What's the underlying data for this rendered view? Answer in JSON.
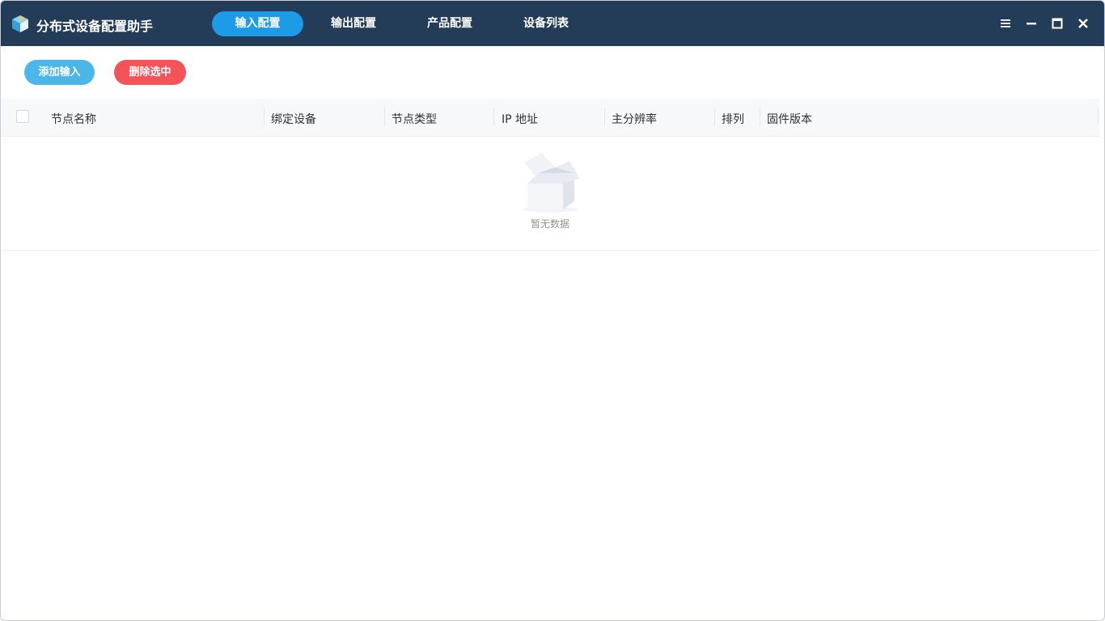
{
  "app": {
    "title": "分布式设备配置助手",
    "logo_icon": "cube-icon"
  },
  "nav": {
    "tabs": [
      {
        "label": "输入配置",
        "active": true
      },
      {
        "label": "输出配置",
        "active": false
      },
      {
        "label": "产品配置",
        "active": false
      },
      {
        "label": "设备列表",
        "active": false
      }
    ],
    "active_color": "#1e9be6"
  },
  "window_controls": [
    "menu-icon",
    "minimize-icon",
    "maximize-icon",
    "close-icon"
  ],
  "toolbar": {
    "add_label": "添加输入",
    "delete_label": "删除选中",
    "add_color": "#4db6e8",
    "delete_color": "#f5535a"
  },
  "table": {
    "columns": [
      "节点名称",
      "绑定设备",
      "节点类型",
      "IP 地址",
      "主分辨率",
      "排列",
      "固件版本"
    ],
    "rows": [],
    "empty_text": "暂无数据"
  },
  "colors": {
    "titlebar": "#233c58"
  }
}
